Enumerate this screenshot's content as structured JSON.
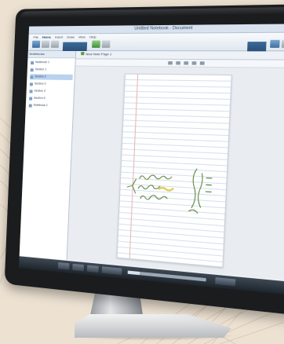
{
  "window": {
    "title": "Untitled Notebook - Document"
  },
  "ribbon": {
    "tabs": [
      "File",
      "Home",
      "Insert",
      "Draw",
      "View",
      "Help"
    ],
    "active_tab": "Home"
  },
  "sidebar": {
    "header": "Notebooks",
    "items": [
      {
        "label": "Notebook 1",
        "selected": false
      },
      {
        "label": "Section 1",
        "selected": false
      },
      {
        "label": "Section 2",
        "selected": true
      },
      {
        "label": "Section 3",
        "selected": false
      },
      {
        "label": "Section 4",
        "selected": false
      },
      {
        "label": "Section 5",
        "selected": false
      },
      {
        "label": "Notebook 2",
        "selected": false
      }
    ]
  },
  "document": {
    "tab_label": "New Note Page 1"
  },
  "audio": {
    "progress": 0.15
  },
  "colors": {
    "accent": "#3b6e9f",
    "ink": "#4e7a2c",
    "highlight": "#d9c43a"
  }
}
